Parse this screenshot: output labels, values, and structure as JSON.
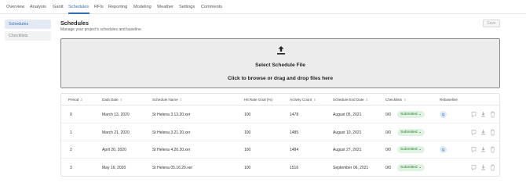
{
  "nav": {
    "tabs": [
      {
        "label": "Overview"
      },
      {
        "label": "Analysis"
      },
      {
        "label": "Gantt"
      },
      {
        "label": "Schedules",
        "active": true
      },
      {
        "label": "RFIs"
      },
      {
        "label": "Reporting"
      },
      {
        "label": "Modeling"
      },
      {
        "label": "Weather"
      },
      {
        "label": "Settings"
      },
      {
        "label": "Comments"
      }
    ]
  },
  "sidebar": {
    "items": [
      {
        "label": "Schedules",
        "active": true
      },
      {
        "label": "Checklists"
      }
    ]
  },
  "header": {
    "title": "Schedules",
    "subtitle": "Manage your project's schedules and baseline.",
    "save_label": "Save"
  },
  "upload": {
    "title": "Select Schedule File",
    "subtitle": "Click to browse or drag and drop files here",
    "icon": "upload-icon"
  },
  "table": {
    "columns": [
      "Period",
      "Data Date",
      "Schedule Name",
      "Hit Rate Goal (%)",
      "Activity Count",
      "Schedule End Date",
      "Checklists",
      "Rebaseline"
    ],
    "rows": [
      {
        "period": "0",
        "data_date": "March 13, 2020",
        "schedule_name": "St Helena 3.13.20.xer",
        "hit_rate": "100",
        "activity_count": "1478",
        "end_date": "August 05, 2021",
        "checklists": "0/0",
        "status": "Submitted",
        "rebaseline": "Q"
      },
      {
        "period": "1",
        "data_date": "March 21, 2020",
        "schedule_name": "St Helena 3.21.20.xer",
        "hit_rate": "100",
        "activity_count": "1485",
        "end_date": "August 10, 2021",
        "checklists": "0/0",
        "status": "Submitted",
        "rebaseline": ""
      },
      {
        "period": "2",
        "data_date": "April 20, 2020",
        "schedule_name": "St Helena 4.20.20.xer",
        "hit_rate": "100",
        "activity_count": "1484",
        "end_date": "August 27, 2021",
        "checklists": "0/0",
        "status": "Submitted",
        "rebaseline": "Q"
      },
      {
        "period": "3",
        "data_date": "May 16, 2020",
        "schedule_name": "St Helena 05.16.20.xer",
        "hit_rate": "100",
        "activity_count": "1516",
        "end_date": "September 06, 2021",
        "checklists": "0/0",
        "status": "Submitted",
        "rebaseline": ""
      }
    ],
    "row_actions": [
      "comment-icon",
      "download-icon",
      "trash-icon"
    ]
  },
  "colors": {
    "accent": "#2f6fb5",
    "badge_bg": "#e0f3e3",
    "badge_text": "#2e7d32",
    "dropzone_bg": "#ececec"
  }
}
